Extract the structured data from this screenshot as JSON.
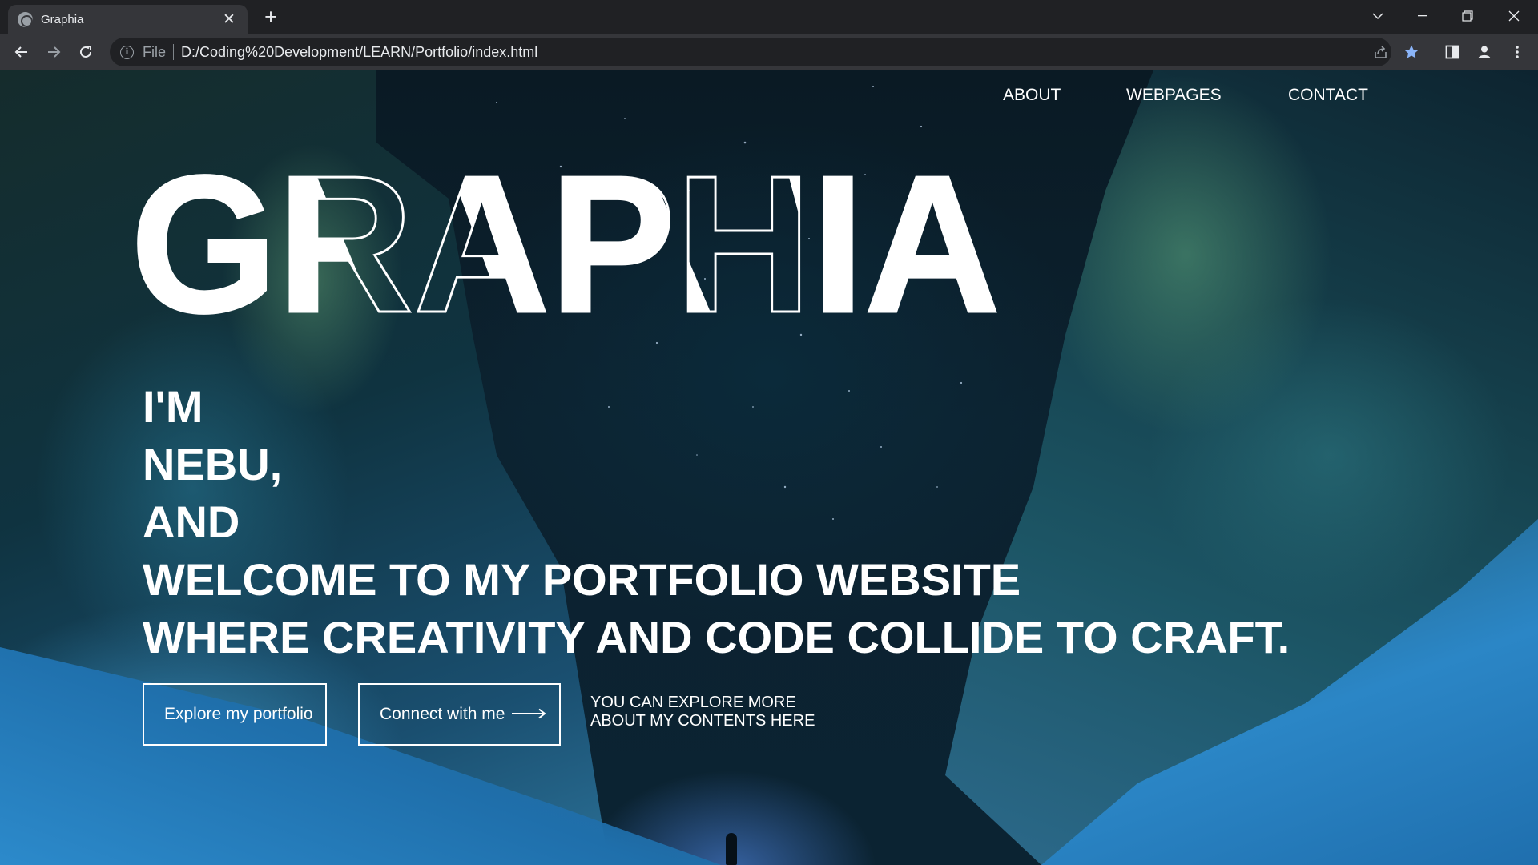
{
  "browser": {
    "tab_title": "Graphia",
    "address_scheme": "File",
    "address_url": "D:/Coding%20Development/LEARN/Portfolio/index.html"
  },
  "nav": {
    "about": "ABOUT",
    "webpages": "WEBPAGES",
    "contact": "CONTACT"
  },
  "hero": {
    "logo_text": "GRAPHIA",
    "lines": [
      "I'M",
      "NEBU,",
      "AND",
      "WELCOME TO MY PORTFOLIO WEBSITE",
      "WHERE CREATIVITY AND CODE COLLIDE TO CRAFT."
    ],
    "explore_button": "Explore my portfolio",
    "connect_button": "Connect with me",
    "note_line1": "YOU CAN EXPLORE MORE",
    "note_line2": "ABOUT MY CONTENTS HERE"
  },
  "colors": {
    "chrome_dark": "#202124",
    "chrome_toolbar": "#35363a",
    "bookmark_star": "#8ab4f8",
    "page_text": "#ffffff"
  },
  "icons": [
    "globe-icon",
    "close-icon",
    "plus-icon",
    "chevron-down-icon",
    "minimize-icon",
    "restore-icon",
    "back-icon",
    "forward-icon",
    "reload-icon",
    "info-icon",
    "share-icon",
    "star-icon",
    "side-panel-icon",
    "profile-icon",
    "menu-icon",
    "arrow-right-icon"
  ]
}
